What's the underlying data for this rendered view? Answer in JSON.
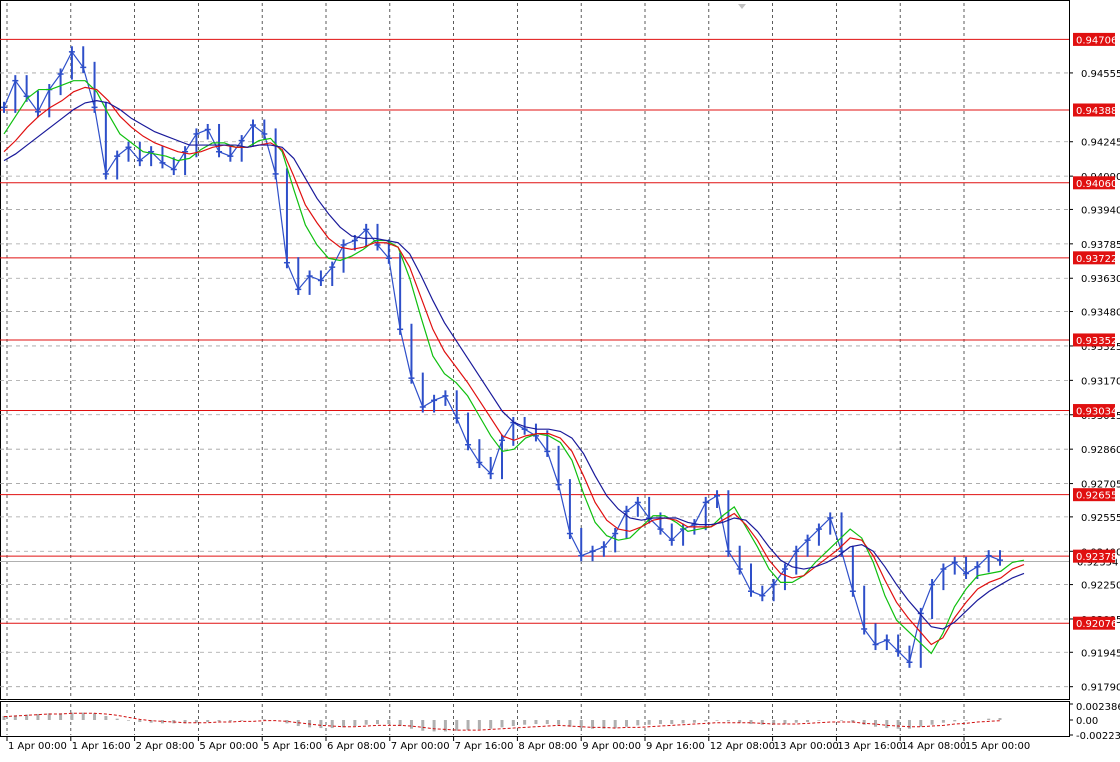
{
  "chart_data": [
    {
      "type": "line",
      "title": "",
      "xlabel": "",
      "ylabel": "",
      "grid": true,
      "ylim": [
        0.9173,
        0.9487
      ],
      "y_ticks": [
        "0.94555",
        "0.94245",
        "0.94090",
        "0.93940",
        "0.93785",
        "0.93630",
        "0.93480",
        "0.93325",
        "0.93170",
        "0.93015",
        "0.92860",
        "0.92705",
        "0.92555",
        "0.92400",
        "0.92250",
        "0.92095",
        "0.91945",
        "0.91790"
      ],
      "x_ticks": [
        "1 Apr 00:00",
        "1 Apr 16:00",
        "2 Apr 08:00",
        "5 Apr 00:00",
        "5 Apr 16:00",
        "6 Apr 08:00",
        "7 Apr 00:00",
        "7 Apr 16:00",
        "8 Apr 08:00",
        "9 Apr 00:00",
        "9 Apr 16:00",
        "12 Apr 08:00",
        "13 Apr 00:00",
        "13 Apr 16:00",
        "14 Apr 08:00",
        "15 Apr 00:00"
      ],
      "horizontal_levels": [
        "0.94706",
        "0.94388",
        "0.94060",
        "0.93722",
        "0.93352",
        "0.93034",
        "0.92655",
        "0.92378",
        "0.92076"
      ],
      "current_price": "0.92354",
      "colors": {
        "price": "#2e4fc9",
        "levels": "#e01010",
        "ma_fast": "#10c010",
        "ma_mid": "#e01010",
        "ma_slow": "#1a1a9a",
        "grid": "#a0a0a0",
        "current_price": "#b0b0b0"
      },
      "series": [
        {
          "values": [
            0.944,
            0.9452,
            0.9445,
            0.9438,
            0.9448,
            0.9455,
            0.9465,
            0.9458,
            0.944,
            0.941,
            0.9418,
            0.9422,
            0.9416,
            0.942,
            0.9415,
            0.9412,
            0.942,
            0.9428,
            0.943,
            0.942,
            0.9418,
            0.9425,
            0.9432,
            0.9428,
            0.941,
            0.937,
            0.9358,
            0.9364,
            0.9362,
            0.9368,
            0.9378,
            0.938,
            0.9385,
            0.9378,
            0.9372,
            0.934,
            0.9318,
            0.9305,
            0.9308,
            0.931,
            0.93,
            0.9288,
            0.928,
            0.9275,
            0.929,
            0.9298,
            0.9295,
            0.9292,
            0.9285,
            0.927,
            0.9248,
            0.9238,
            0.924,
            0.9242,
            0.9248,
            0.9258,
            0.9262,
            0.9255,
            0.925,
            0.9245,
            0.925,
            0.9252,
            0.9262,
            0.9265,
            0.924,
            0.9232,
            0.9222,
            0.922,
            0.9225,
            0.9232,
            0.924,
            0.9245,
            0.925,
            0.9255,
            0.924,
            0.9222,
            0.9205,
            0.9198,
            0.92,
            0.9195,
            0.919,
            0.9212,
            0.9225,
            0.9232,
            0.9235,
            0.923,
            0.9233,
            0.9238,
            0.9236
          ]
        },
        {
          "values": [
            0.9428,
            0.9436,
            0.9444,
            0.9448,
            0.9448,
            0.945,
            0.9452,
            0.9452,
            0.9447,
            0.9437,
            0.9428,
            0.9424,
            0.942,
            0.9419,
            0.9418,
            0.9416,
            0.9417,
            0.9421,
            0.9424,
            0.9424,
            0.9422,
            0.9422,
            0.9425,
            0.9426,
            0.942,
            0.9403,
            0.9387,
            0.9378,
            0.9372,
            0.9371,
            0.9373,
            0.9376,
            0.938,
            0.938,
            0.9377,
            0.9363,
            0.9345,
            0.9328,
            0.932,
            0.9316,
            0.931,
            0.9301,
            0.9292,
            0.9285,
            0.9286,
            0.9291,
            0.9293,
            0.9292,
            0.9289,
            0.9281,
            0.9266,
            0.9253,
            0.9247,
            0.9245,
            0.9246,
            0.9251,
            0.9256,
            0.9256,
            0.9253,
            0.9249,
            0.925,
            0.9251,
            0.9256,
            0.926,
            0.9251,
            0.9242,
            0.9232,
            0.9226,
            0.9226,
            0.9229,
            0.9235,
            0.924,
            0.9245,
            0.925,
            0.9246,
            0.9235,
            0.922,
            0.9209,
            0.9204,
            0.9199,
            0.9194,
            0.9203,
            0.9215,
            0.9223,
            0.9229,
            0.923,
            0.9231,
            0.9235,
            0.9236
          ]
        },
        {
          "values": [
            0.942,
            0.9425,
            0.9431,
            0.9436,
            0.944,
            0.9443,
            0.9447,
            0.9449,
            0.9448,
            0.9443,
            0.9436,
            0.9431,
            0.9427,
            0.9424,
            0.9422,
            0.942,
            0.9419,
            0.942,
            0.9422,
            0.9423,
            0.9422,
            0.9422,
            0.9423,
            0.9424,
            0.9421,
            0.9409,
            0.9396,
            0.9388,
            0.9381,
            0.9377,
            0.9376,
            0.9377,
            0.9379,
            0.9379,
            0.9377,
            0.9368,
            0.9354,
            0.934,
            0.933,
            0.9323,
            0.9316,
            0.9308,
            0.93,
            0.9292,
            0.929,
            0.9292,
            0.9293,
            0.9293,
            0.9291,
            0.9285,
            0.9274,
            0.9262,
            0.9254,
            0.925,
            0.9249,
            0.9251,
            0.9254,
            0.9255,
            0.9254,
            0.9251,
            0.9251,
            0.9251,
            0.9254,
            0.9257,
            0.9252,
            0.9245,
            0.9236,
            0.923,
            0.9228,
            0.9229,
            0.9233,
            0.9237,
            0.9241,
            0.9246,
            0.9245,
            0.9238,
            0.9227,
            0.9217,
            0.921,
            0.9204,
            0.9198,
            0.9201,
            0.921,
            0.9217,
            0.9223,
            0.9226,
            0.9228,
            0.9232,
            0.9234
          ]
        },
        {
          "values": [
            0.9416,
            0.9419,
            0.9423,
            0.9427,
            0.9431,
            0.9435,
            0.9439,
            0.9442,
            0.9443,
            0.9442,
            0.9439,
            0.9435,
            0.9432,
            0.9429,
            0.9427,
            0.9425,
            0.9423,
            0.9423,
            0.9423,
            0.9423,
            0.9423,
            0.9422,
            0.9423,
            0.9423,
            0.9422,
            0.9417,
            0.9408,
            0.9399,
            0.9392,
            0.9386,
            0.9382,
            0.9381,
            0.9381,
            0.938,
            0.9379,
            0.9374,
            0.9364,
            0.9353,
            0.9343,
            0.9335,
            0.9327,
            0.9319,
            0.9311,
            0.9303,
            0.9298,
            0.9296,
            0.9295,
            0.9295,
            0.9294,
            0.9291,
            0.9284,
            0.9274,
            0.9265,
            0.9259,
            0.9255,
            0.9254,
            0.9255,
            0.9255,
            0.9255,
            0.9253,
            0.9252,
            0.9252,
            0.9253,
            0.9255,
            0.9254,
            0.9249,
            0.9242,
            0.9236,
            0.9233,
            0.9232,
            0.9233,
            0.9235,
            0.9238,
            0.9242,
            0.9243,
            0.924,
            0.9233,
            0.9225,
            0.9218,
            0.9212,
            0.9206,
            0.9205,
            0.9208,
            0.9213,
            0.9218,
            0.9222,
            0.9225,
            0.9228,
            0.923
          ]
        }
      ]
    },
    {
      "type": "bar",
      "title": "",
      "ylim": [
        -0.002234,
        0.002386
      ],
      "y_ticks": [
        "0.002386",
        "0.00",
        "-0.002234"
      ],
      "series": [
        {
          "values": [
            0.0006,
            0.0007,
            0.0008,
            0.0009,
            0.001,
            0.001,
            0.0011,
            0.0011,
            0.001,
            0.0006,
            0.0002,
            -0.0001,
            -0.0003,
            -0.0004,
            -0.0005,
            -0.0005,
            -0.0005,
            -0.0004,
            -0.0003,
            -0.0002,
            -0.0002,
            -0.0001,
            0.0,
            0.0001,
            0.0,
            -0.0005,
            -0.0009,
            -0.0011,
            -0.0012,
            -0.0012,
            -0.0011,
            -0.0009,
            -0.0007,
            -0.0006,
            -0.0006,
            -0.0009,
            -0.0013,
            -0.0016,
            -0.0017,
            -0.0017,
            -0.0016,
            -0.0015,
            -0.0014,
            -0.0013,
            -0.0011,
            -0.0009,
            -0.0007,
            -0.0006,
            -0.0006,
            -0.0007,
            -0.001,
            -0.0012,
            -0.0013,
            -0.0013,
            -0.0012,
            -0.001,
            -0.0008,
            -0.0007,
            -0.0006,
            -0.0006,
            -0.0005,
            -0.0004,
            -0.0002,
            -0.0001,
            -0.0002,
            -0.0004,
            -0.0006,
            -0.0007,
            -0.0007,
            -0.0006,
            -0.0004,
            -0.0003,
            -0.0001,
            0.0,
            -0.0001,
            -0.0004,
            -0.0007,
            -0.001,
            -0.0012,
            -0.0013,
            -0.0013,
            -0.001,
            -0.0007,
            -0.0004,
            -0.0002,
            -0.0001,
            0.0,
            0.0002,
            0.0003
          ]
        },
        {
          "values": [
            0.0005,
            0.0006,
            0.0007,
            0.0008,
            0.0009,
            0.0009,
            0.001,
            0.001,
            0.001,
            0.0009,
            0.0007,
            0.0004,
            0.0001,
            -0.0001,
            -0.0002,
            -0.0003,
            -0.0004,
            -0.0004,
            -0.0004,
            -0.0003,
            -0.0003,
            -0.0002,
            -0.0002,
            -0.0001,
            -0.0001,
            -0.0002,
            -0.0004,
            -0.0006,
            -0.0008,
            -0.0009,
            -0.001,
            -0.001,
            -0.0009,
            -0.0008,
            -0.0008,
            -0.0008,
            -0.0009,
            -0.0011,
            -0.0013,
            -0.0014,
            -0.0015,
            -0.0015,
            -0.0015,
            -0.0014,
            -0.0013,
            -0.0012,
            -0.0011,
            -0.001,
            -0.0009,
            -0.0008,
            -0.0009,
            -0.001,
            -0.0011,
            -0.0011,
            -0.0012,
            -0.0011,
            -0.0011,
            -0.001,
            -0.0009,
            -0.0008,
            -0.0007,
            -0.0006,
            -0.0005,
            -0.0004,
            -0.0004,
            -0.0004,
            -0.0004,
            -0.0005,
            -0.0006,
            -0.0006,
            -0.0006,
            -0.0005,
            -0.0004,
            -0.0003,
            -0.0003,
            -0.0003,
            -0.0005,
            -0.0006,
            -0.0008,
            -0.0009,
            -0.001,
            -0.001,
            -0.0009,
            -0.0008,
            -0.0006,
            -0.0005,
            -0.0003,
            -0.0002,
            -0.0001
          ]
        }
      ]
    }
  ]
}
